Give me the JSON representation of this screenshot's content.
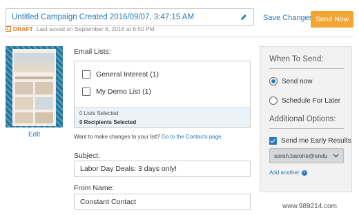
{
  "header": {
    "campaign_title": "Untitled Campaign Created 2016/09/07, 3:47:15 AM",
    "save_changes": "Save Changes",
    "send_now": "Send Now",
    "draft_label": "DRAFT",
    "last_saved": "Last saved on September 6, 2016 at 6:50 PM"
  },
  "preview": {
    "edit": "Edit"
  },
  "email_lists": {
    "label": "Email Lists:",
    "items": [
      {
        "label": "General Interest (1)",
        "checked": false
      },
      {
        "label": "My Demo List (1)",
        "checked": false
      }
    ],
    "lists_selected": "0 Lists Selected",
    "recipients_selected": "0 Recipients Selected",
    "contacts_hint": "Want to make changes to your list?",
    "contacts_link": "Go to the Contacts page."
  },
  "subject": {
    "label": "Subject:",
    "value": "Labor Day Deals: 3 days only!"
  },
  "from_name": {
    "label": "From Name:",
    "value": "Constant Contact"
  },
  "send_panel": {
    "when_to_send": "When To Send:",
    "send_now": "Send now",
    "schedule_later": "Schedule For Later",
    "selected": "send_now",
    "additional_options": "Additional Options:",
    "early_results": "Send me Early Results",
    "early_results_checked": true,
    "email_value": "sarah.barone@endu",
    "add_another": "Add another"
  },
  "watermark": "www.989214.com",
  "colors": {
    "accent": "#2a79b8",
    "send_button": "#f3a534",
    "draft": "#e07c1f"
  }
}
